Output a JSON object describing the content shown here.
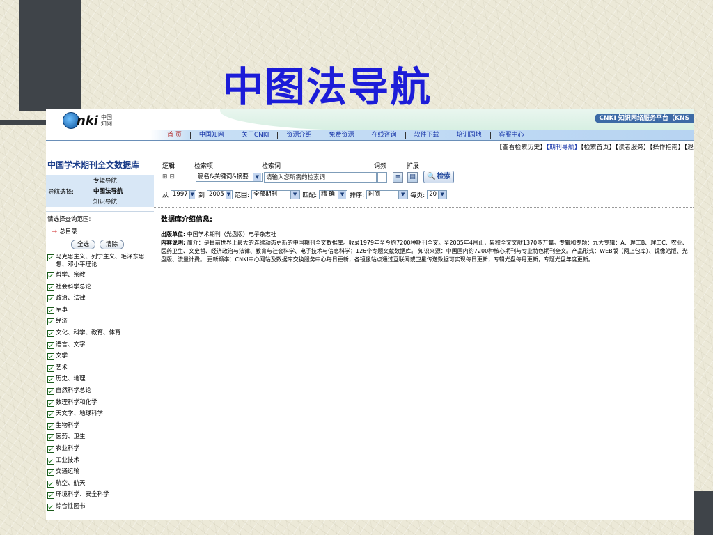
{
  "slide_title": "中图法导航",
  "logo": {
    "text": "nki",
    "cn": "中国\n知网"
  },
  "platform_title": "CNKI 知识网络服务平台（KNS",
  "nav_items": [
    "首 页",
    "中国知网",
    "关于CNKI",
    "资源介绍",
    "免费资源",
    "在线咨询",
    "软件下载",
    "培训园地",
    "客服中心"
  ],
  "sublinks": {
    "history": "【查看检索历史】",
    "journal_nav": "【期刊导航】",
    "search_home": "【检索首页】",
    "reader_service": "【读者服务】",
    "guide": "【操作指南】",
    "exit": "【退"
  },
  "sidebar": {
    "db_title": "中国学术期刊全文数据库",
    "nav_label": "导航选择:",
    "nav_options": [
      "专辑导航",
      "中图法导航",
      "知识导航"
    ],
    "selected_nav": "中图法导航",
    "scope_label": "请选择查询范围:",
    "root": "总目录",
    "select_all": "全选",
    "clear": "清除",
    "categories": [
      "马克思主义、列宁主义、毛泽东思想、邓小平理论",
      "哲学、宗教",
      "社会科学总论",
      "政治、法律",
      "军事",
      "经济",
      "文化、科学、教育、体育",
      "语言、文字",
      "文学",
      "艺术",
      "历史、地理",
      "自然科学总论",
      "数理科学和化学",
      "天文学、地球科学",
      "生物科学",
      "医药、卫生",
      "农业科学",
      "工业技术",
      "交通运输",
      "航空、航天",
      "环境科学、安全科学",
      "综合性图书"
    ]
  },
  "search": {
    "label_logic": "逻辑",
    "label_field": "检索项",
    "label_term": "检索词",
    "label_freq": "词频",
    "label_expand": "扩展",
    "expand_ctrls": "⊞ ⊟",
    "field_value": "篇名&关键词&摘要",
    "term_placeholder": "请输入您所需的检索词",
    "search_btn": "检索"
  },
  "filters": {
    "from_label": "从",
    "from_year": "1997",
    "to_label": "到",
    "to_year": "2005",
    "range_label": "范围:",
    "range_value": "全部期刊",
    "match_label": "匹配:",
    "match_value": "精 确",
    "sort_label": "排序:",
    "sort_value": "时间",
    "per_page_label": "每页:",
    "per_page_value": "20"
  },
  "info": {
    "title": "数据库介绍信息:",
    "publisher_label": "出版单位:",
    "publisher": "中国学术期刊（光盘版）电子杂志社",
    "content_label": "内容说明:",
    "content": "简介：是目前世界上最大的连续动态更新的中国期刊全文数据库。收录1979年至今约7200种期刊全文。至2005年4月止，累积全文文献1370多万篇。专辑和专题：九大专辑：A、理工B、理工C、农业、医药卫生、文史哲、经济政治与法律、教育与社会科学、电子技术与信息科学；126个专题文献数据库。 知识来源：中国国内约7200种核心期刊与专业特色期刊全文。产品形式：WEB版（网上包库）、镜像站版、光盘版、流量计费。 更新频率：CNKI中心网站及数据库交换服务中心每日更新，各镜像站点通过互联网或卫星传送数据可实现每日更新，专辑光盘每月更新，专题光盘年度更新。"
  }
}
